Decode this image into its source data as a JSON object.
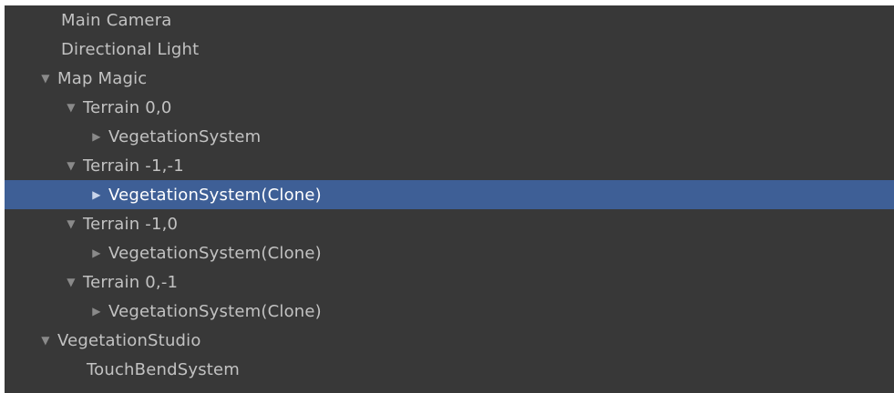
{
  "hierarchy": {
    "items": [
      {
        "label": "Main Camera",
        "depth": 0,
        "toggle": "none"
      },
      {
        "label": "Directional Light",
        "depth": 0,
        "toggle": "none"
      },
      {
        "label": "Map Magic",
        "depth": 0,
        "toggle": "expanded"
      },
      {
        "label": "Terrain 0,0",
        "depth": 1,
        "toggle": "expanded"
      },
      {
        "label": "VegetationSystem",
        "depth": 2,
        "toggle": "collapsed"
      },
      {
        "label": "Terrain -1,-1",
        "depth": 1,
        "toggle": "expanded"
      },
      {
        "label": "VegetationSystem(Clone)",
        "depth": 2,
        "toggle": "collapsed",
        "selected": true
      },
      {
        "label": "Terrain -1,0",
        "depth": 1,
        "toggle": "expanded"
      },
      {
        "label": "VegetationSystem(Clone)",
        "depth": 2,
        "toggle": "collapsed"
      },
      {
        "label": "Terrain 0,-1",
        "depth": 1,
        "toggle": "expanded"
      },
      {
        "label": "VegetationSystem(Clone)",
        "depth": 2,
        "toggle": "collapsed"
      },
      {
        "label": "VegetationStudio",
        "depth": 0,
        "toggle": "expanded"
      },
      {
        "label": "TouchBendSystem",
        "depth": 1,
        "toggle": "none"
      }
    ],
    "icons": {
      "expanded": "triangle-down-icon",
      "collapsed": "triangle-right-icon"
    },
    "colors": {
      "background": "#383838",
      "selected": "#3e5f96",
      "text": "#c2c2c2",
      "selected_text": "#ffffff",
      "arrow": "#8a8a8a"
    }
  }
}
